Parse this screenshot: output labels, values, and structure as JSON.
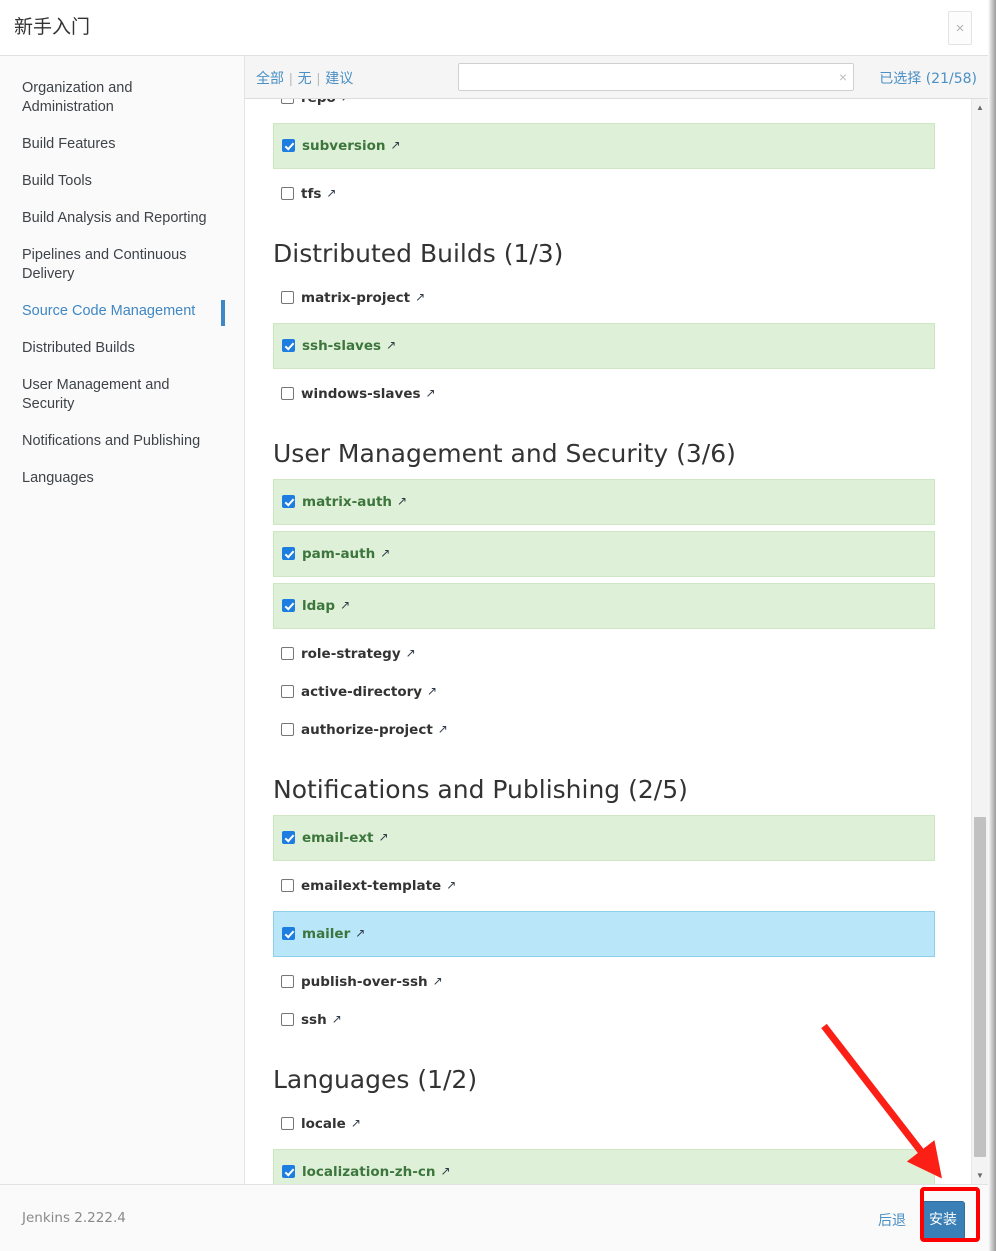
{
  "window": {
    "title": "新手入门",
    "close_label": "×"
  },
  "sidebar": {
    "items": [
      {
        "label": "Organization and Administration",
        "active": false
      },
      {
        "label": "Build Features",
        "active": false
      },
      {
        "label": "Build Tools",
        "active": false
      },
      {
        "label": "Build Analysis and Reporting",
        "active": false
      },
      {
        "label": "Pipelines and Continuous Delivery",
        "active": false
      },
      {
        "label": "Source Code Management",
        "active": true
      },
      {
        "label": "Distributed Builds",
        "active": false
      },
      {
        "label": "User Management and Security",
        "active": false
      },
      {
        "label": "Notifications and Publishing",
        "active": false
      },
      {
        "label": "Languages",
        "active": false
      }
    ]
  },
  "toolbar": {
    "filter_all": "全部",
    "filter_none": "无",
    "filter_suggested": "建议",
    "separator": "|",
    "search_value": "",
    "search_placeholder": "",
    "search_clear": "×",
    "selected_label": "已选择 (21/58)"
  },
  "list": {
    "blocks": [
      {
        "kind": "row",
        "name": "repo",
        "checked": false,
        "hovered": false,
        "clipped": true
      },
      {
        "kind": "row",
        "name": "subversion",
        "checked": true,
        "hovered": false
      },
      {
        "kind": "row",
        "name": "tfs",
        "checked": false,
        "hovered": false
      },
      {
        "kind": "heading",
        "title": "Distributed Builds (1/3)"
      },
      {
        "kind": "row",
        "name": "matrix-project",
        "checked": false,
        "hovered": false
      },
      {
        "kind": "row",
        "name": "ssh-slaves",
        "checked": true,
        "hovered": false
      },
      {
        "kind": "row",
        "name": "windows-slaves",
        "checked": false,
        "hovered": false
      },
      {
        "kind": "heading",
        "title": "User Management and Security (3/6)"
      },
      {
        "kind": "row",
        "name": "matrix-auth",
        "checked": true,
        "hovered": false
      },
      {
        "kind": "row",
        "name": "pam-auth",
        "checked": true,
        "hovered": false
      },
      {
        "kind": "row",
        "name": "ldap",
        "checked": true,
        "hovered": false
      },
      {
        "kind": "row",
        "name": "role-strategy",
        "checked": false,
        "hovered": false
      },
      {
        "kind": "row",
        "name": "active-directory",
        "checked": false,
        "hovered": false
      },
      {
        "kind": "row",
        "name": "authorize-project",
        "checked": false,
        "hovered": false
      },
      {
        "kind": "heading",
        "title": "Notifications and Publishing (2/5)"
      },
      {
        "kind": "row",
        "name": "email-ext",
        "checked": true,
        "hovered": false
      },
      {
        "kind": "row",
        "name": "emailext-template",
        "checked": false,
        "hovered": false
      },
      {
        "kind": "row",
        "name": "mailer",
        "checked": true,
        "hovered": true
      },
      {
        "kind": "row",
        "name": "publish-over-ssh",
        "checked": false,
        "hovered": false
      },
      {
        "kind": "row",
        "name": "ssh",
        "checked": false,
        "hovered": false
      },
      {
        "kind": "heading",
        "title": "Languages (1/2)"
      },
      {
        "kind": "row",
        "name": "locale",
        "checked": false,
        "hovered": false
      },
      {
        "kind": "row",
        "name": "localization-zh-cn",
        "checked": true,
        "hovered": false
      }
    ],
    "external_link_glyph": "↗"
  },
  "scrollbar": {
    "up_glyph": "▲",
    "down_glyph": "▼"
  },
  "footer": {
    "version": "Jenkins 2.222.4",
    "back_label": "后退",
    "install_label": "安装"
  },
  "colors": {
    "accent": "#4a90c4",
    "checked_bg": "#dff0d8",
    "checked_text": "#3c763d",
    "hover_bg": "#b9e6f8",
    "checkbox_on": "#1e7de0",
    "install_button": "#3a7fb5",
    "annotation": "#ff0000"
  }
}
